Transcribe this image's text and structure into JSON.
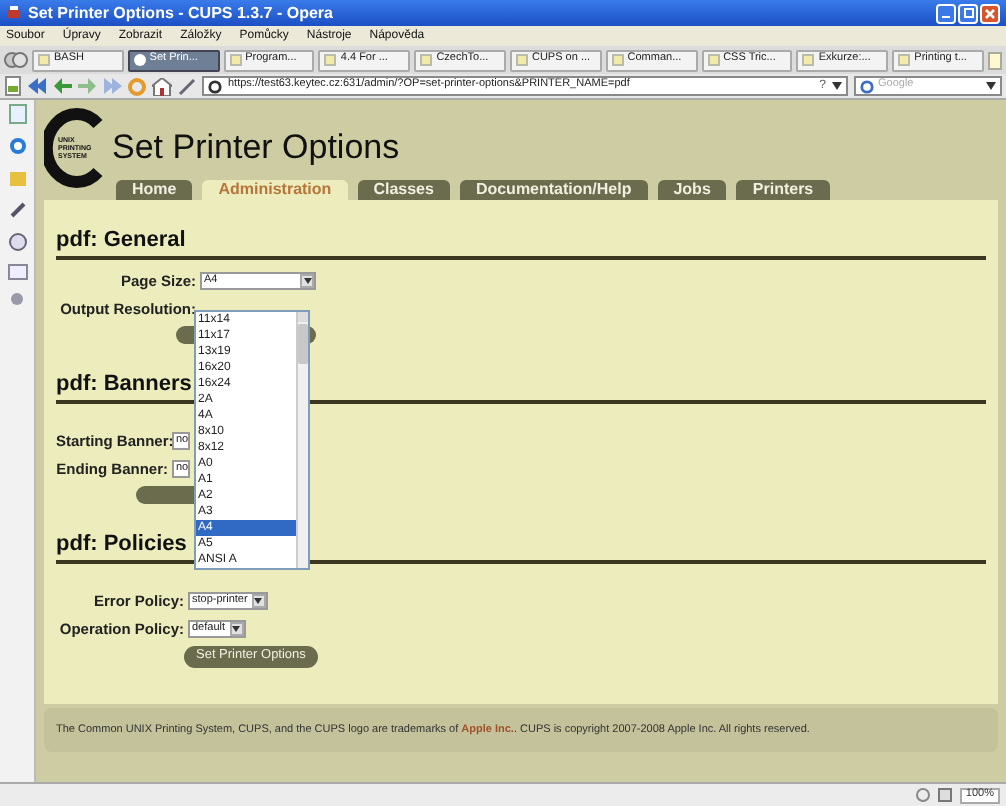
{
  "window": {
    "title": "Set Printer Options - CUPS 1.3.7 - Opera"
  },
  "menu": [
    "Soubor",
    "Úpravy",
    "Zobrazit",
    "Záložky",
    "Pomůcky",
    "Nástroje",
    "Nápověda"
  ],
  "browser_tabs": [
    {
      "label": "BASH",
      "selected": false
    },
    {
      "label": "Set Prin...",
      "selected": true
    },
    {
      "label": "Program...",
      "selected": false
    },
    {
      "label": "4.4 For ...",
      "selected": false
    },
    {
      "label": "CzechTo...",
      "selected": false
    },
    {
      "label": "CUPS on ...",
      "selected": false
    },
    {
      "label": "Comman...",
      "selected": false
    },
    {
      "label": "CSS Tric...",
      "selected": false
    },
    {
      "label": "Exkurze:...",
      "selected": false
    },
    {
      "label": "Printing t...",
      "selected": false
    }
  ],
  "address_bar": {
    "url": "https://test63.keytec.cz:631/admin/?OP=set-printer-options&PRINTER_NAME=pdf",
    "help_button": "?"
  },
  "search": {
    "placeholder": "Google"
  },
  "page": {
    "logo_text": "UNIX PRINTING SYSTEM",
    "title": "Set Printer Options",
    "tabs": [
      {
        "label": "Home",
        "selected": false
      },
      {
        "label": "Administration",
        "selected": true
      },
      {
        "label": "Classes",
        "selected": false
      },
      {
        "label": "Documentation/Help",
        "selected": false
      },
      {
        "label": "Jobs",
        "selected": false
      },
      {
        "label": "Printers",
        "selected": false
      }
    ],
    "sections": [
      {
        "heading": "pdf: General",
        "fields": [
          {
            "label": "Page Size:",
            "value": "A4"
          },
          {
            "label": "Output Resolution:"
          }
        ]
      },
      {
        "heading": "pdf: Banners",
        "fields": [
          {
            "label": "Starting Banner:",
            "value": "no"
          },
          {
            "label": "Ending Banner:",
            "value": "no"
          }
        ]
      },
      {
        "heading": "pdf: Policies",
        "fields": [
          {
            "label": "Error Policy:",
            "value": "stop-printer"
          },
          {
            "label": "Operation Policy:",
            "value": "default"
          }
        ],
        "button": "Set Printer Options"
      }
    ],
    "dropdown": {
      "options": [
        {
          "label": "11x14",
          "selected": false
        },
        {
          "label": "11x17",
          "selected": false
        },
        {
          "label": "13x19",
          "selected": false
        },
        {
          "label": "16x20",
          "selected": false
        },
        {
          "label": "16x24",
          "selected": false
        },
        {
          "label": "2A",
          "selected": false
        },
        {
          "label": "4A",
          "selected": false
        },
        {
          "label": "8x10",
          "selected": false
        },
        {
          "label": "8x12",
          "selected": false
        },
        {
          "label": "A0",
          "selected": false
        },
        {
          "label": "A1",
          "selected": false
        },
        {
          "label": "A2",
          "selected": false
        },
        {
          "label": "A3",
          "selected": false
        },
        {
          "label": "A4",
          "selected": true
        },
        {
          "label": "A5",
          "selected": false
        },
        {
          "label": "ANSI A",
          "selected": false
        }
      ]
    },
    "footer": {
      "text_before": "The Common UNIX Printing System, CUPS, and the CUPS logo are trademarks of",
      "link": "Apple Inc.",
      "text_after": ". CUPS is copyright 2007-2008 Apple Inc. All rights reserved."
    }
  },
  "status_bar": {
    "zoom": "100%"
  }
}
